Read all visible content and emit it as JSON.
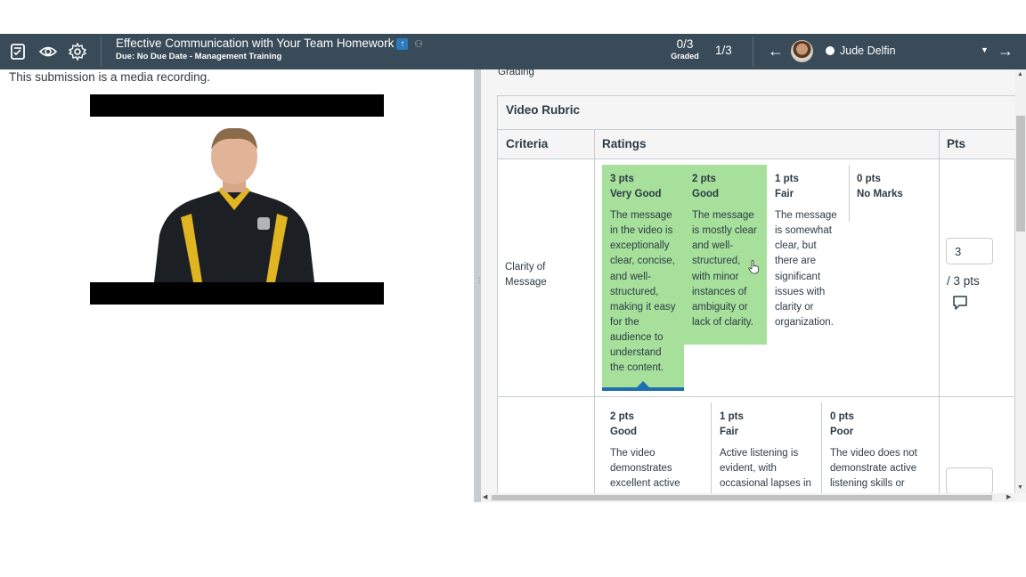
{
  "header": {
    "assignment_title": "Effective Communication with Your Team Homework",
    "subtitle": "Due: No Due Date - Management Training",
    "graded_count": "0/3",
    "graded_label": "Graded",
    "student_position": "1/3",
    "student_name": "Jude Delfin",
    "icons": [
      "gradebook-icon",
      "eye-icon",
      "gear-icon",
      "upload-icon",
      "accessibility-icon",
      "arrow-left-icon",
      "arrow-right-icon",
      "chevron-down-icon"
    ]
  },
  "submission": {
    "note": "This submission is a media recording."
  },
  "grading": {
    "section_label": "Grading",
    "rubric_title": "Video Rubric",
    "columns": {
      "criteria": "Criteria",
      "ratings": "Ratings",
      "pts": "Pts"
    },
    "criteria": [
      {
        "name": "Clarity of Message",
        "score": "3",
        "out_of": "/ 3 pts",
        "ratings": [
          {
            "pts": "3 pts",
            "name": "Very Good",
            "desc": "The message in the video is exceptionally clear, concise, and well-structured, making it easy for the audience to understand the content.",
            "selected": true
          },
          {
            "pts": "2 pts",
            "name": "Good",
            "desc": "The message is mostly clear and well-structured, with minor instances of ambiguity or lack of clarity.",
            "selected": false
          },
          {
            "pts": "1 pts",
            "name": "Fair",
            "desc": "The message is somewhat clear, but there are significant issues with clarity or organization.",
            "selected": false
          },
          {
            "pts": "0 pts",
            "name": "No Marks",
            "desc": "",
            "selected": false
          }
        ]
      },
      {
        "name": "",
        "score": "",
        "out_of": "",
        "ratings": [
          {
            "pts": "2 pts",
            "name": "Good",
            "desc": "The video demonstrates excellent active"
          },
          {
            "pts": "1 pts",
            "name": "Fair",
            "desc": "Active listening is evident, with occasional lapses in"
          },
          {
            "pts": "0 pts",
            "name": "Poor",
            "desc": "The video does not demonstrate active listening skills or"
          }
        ]
      }
    ]
  },
  "colors": {
    "header_bg": "#394b58",
    "selected_rating": "#a6e09b",
    "selected_indicator": "#1f6fb0"
  }
}
